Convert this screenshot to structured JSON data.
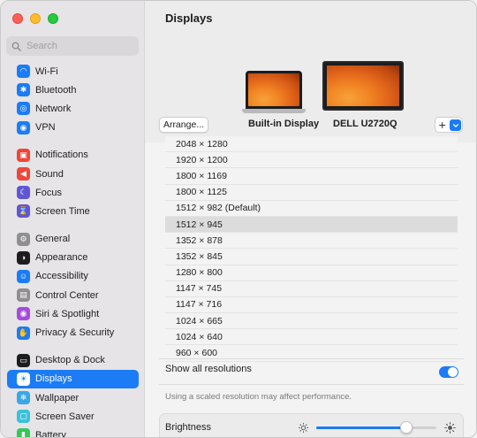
{
  "sidebar": {
    "search_placeholder": "Search",
    "groups": [
      [
        {
          "label": "Wi-Fi",
          "icon": "wifi-icon",
          "color": "#1b7cf5"
        },
        {
          "label": "Bluetooth",
          "icon": "bluetooth-icon",
          "color": "#1b7cf5"
        },
        {
          "label": "Network",
          "icon": "network-icon",
          "color": "#1b7cf5"
        },
        {
          "label": "VPN",
          "icon": "vpn-icon",
          "color": "#1b7cf5"
        }
      ],
      [
        {
          "label": "Notifications",
          "icon": "notifications-icon",
          "color": "#f0453a"
        },
        {
          "label": "Sound",
          "icon": "sound-icon",
          "color": "#f0453a"
        },
        {
          "label": "Focus",
          "icon": "focus-icon",
          "color": "#5f56d6"
        },
        {
          "label": "Screen Time",
          "icon": "screen-time-icon",
          "color": "#5f56d6"
        }
      ],
      [
        {
          "label": "General",
          "icon": "general-icon",
          "color": "#8e8e93"
        },
        {
          "label": "Appearance",
          "icon": "appearance-icon",
          "color": "#1d1d1f"
        },
        {
          "label": "Accessibility",
          "icon": "accessibility-icon",
          "color": "#1b7cf5"
        },
        {
          "label": "Control Center",
          "icon": "control-center-icon",
          "color": "#8e8e93"
        },
        {
          "label": "Siri & Spotlight",
          "icon": "siri-icon",
          "color": "#a54be0"
        },
        {
          "label": "Privacy & Security",
          "icon": "privacy-hand-icon",
          "color": "#1b7cf5"
        }
      ],
      [
        {
          "label": "Desktop & Dock",
          "icon": "desktop-dock-icon",
          "color": "#1d1d1f"
        },
        {
          "label": "Displays",
          "icon": "displays-sun-icon",
          "color": "#1b7cf5",
          "active": true
        },
        {
          "label": "Wallpaper",
          "icon": "wallpaper-icon",
          "color": "#3aa7e6"
        },
        {
          "label": "Screen Saver",
          "icon": "screen-saver-icon",
          "color": "#3ac2d8"
        },
        {
          "label": "Battery",
          "icon": "battery-icon",
          "color": "#34c759"
        }
      ]
    ]
  },
  "main": {
    "title": "Displays",
    "arrange_label": "Arrange...",
    "displays": {
      "builtin_label": "Built-in Display",
      "external_label": "DELL U2720Q"
    },
    "plus_label": "+",
    "resolutions": [
      "2048 × 1280",
      "1920 × 1200",
      "1800 × 1169",
      "1800 × 1125",
      "1512 × 982 (Default)",
      "1512 × 945",
      "1352 × 878",
      "1352 × 845",
      "1280 × 800",
      "1147 × 745",
      "1147 × 716",
      "1024 × 665",
      "1024 × 640",
      "960 × 600"
    ],
    "selected_resolution": "1512 × 945",
    "show_all_label": "Show all resolutions",
    "show_all_on": true,
    "note": "Using a scaled resolution may affect performance.",
    "brightness_label": "Brightness",
    "brightness_level": 0.75
  },
  "colors": {
    "accent": "#1b7cf5",
    "selected_row": "#dcdcdc"
  }
}
